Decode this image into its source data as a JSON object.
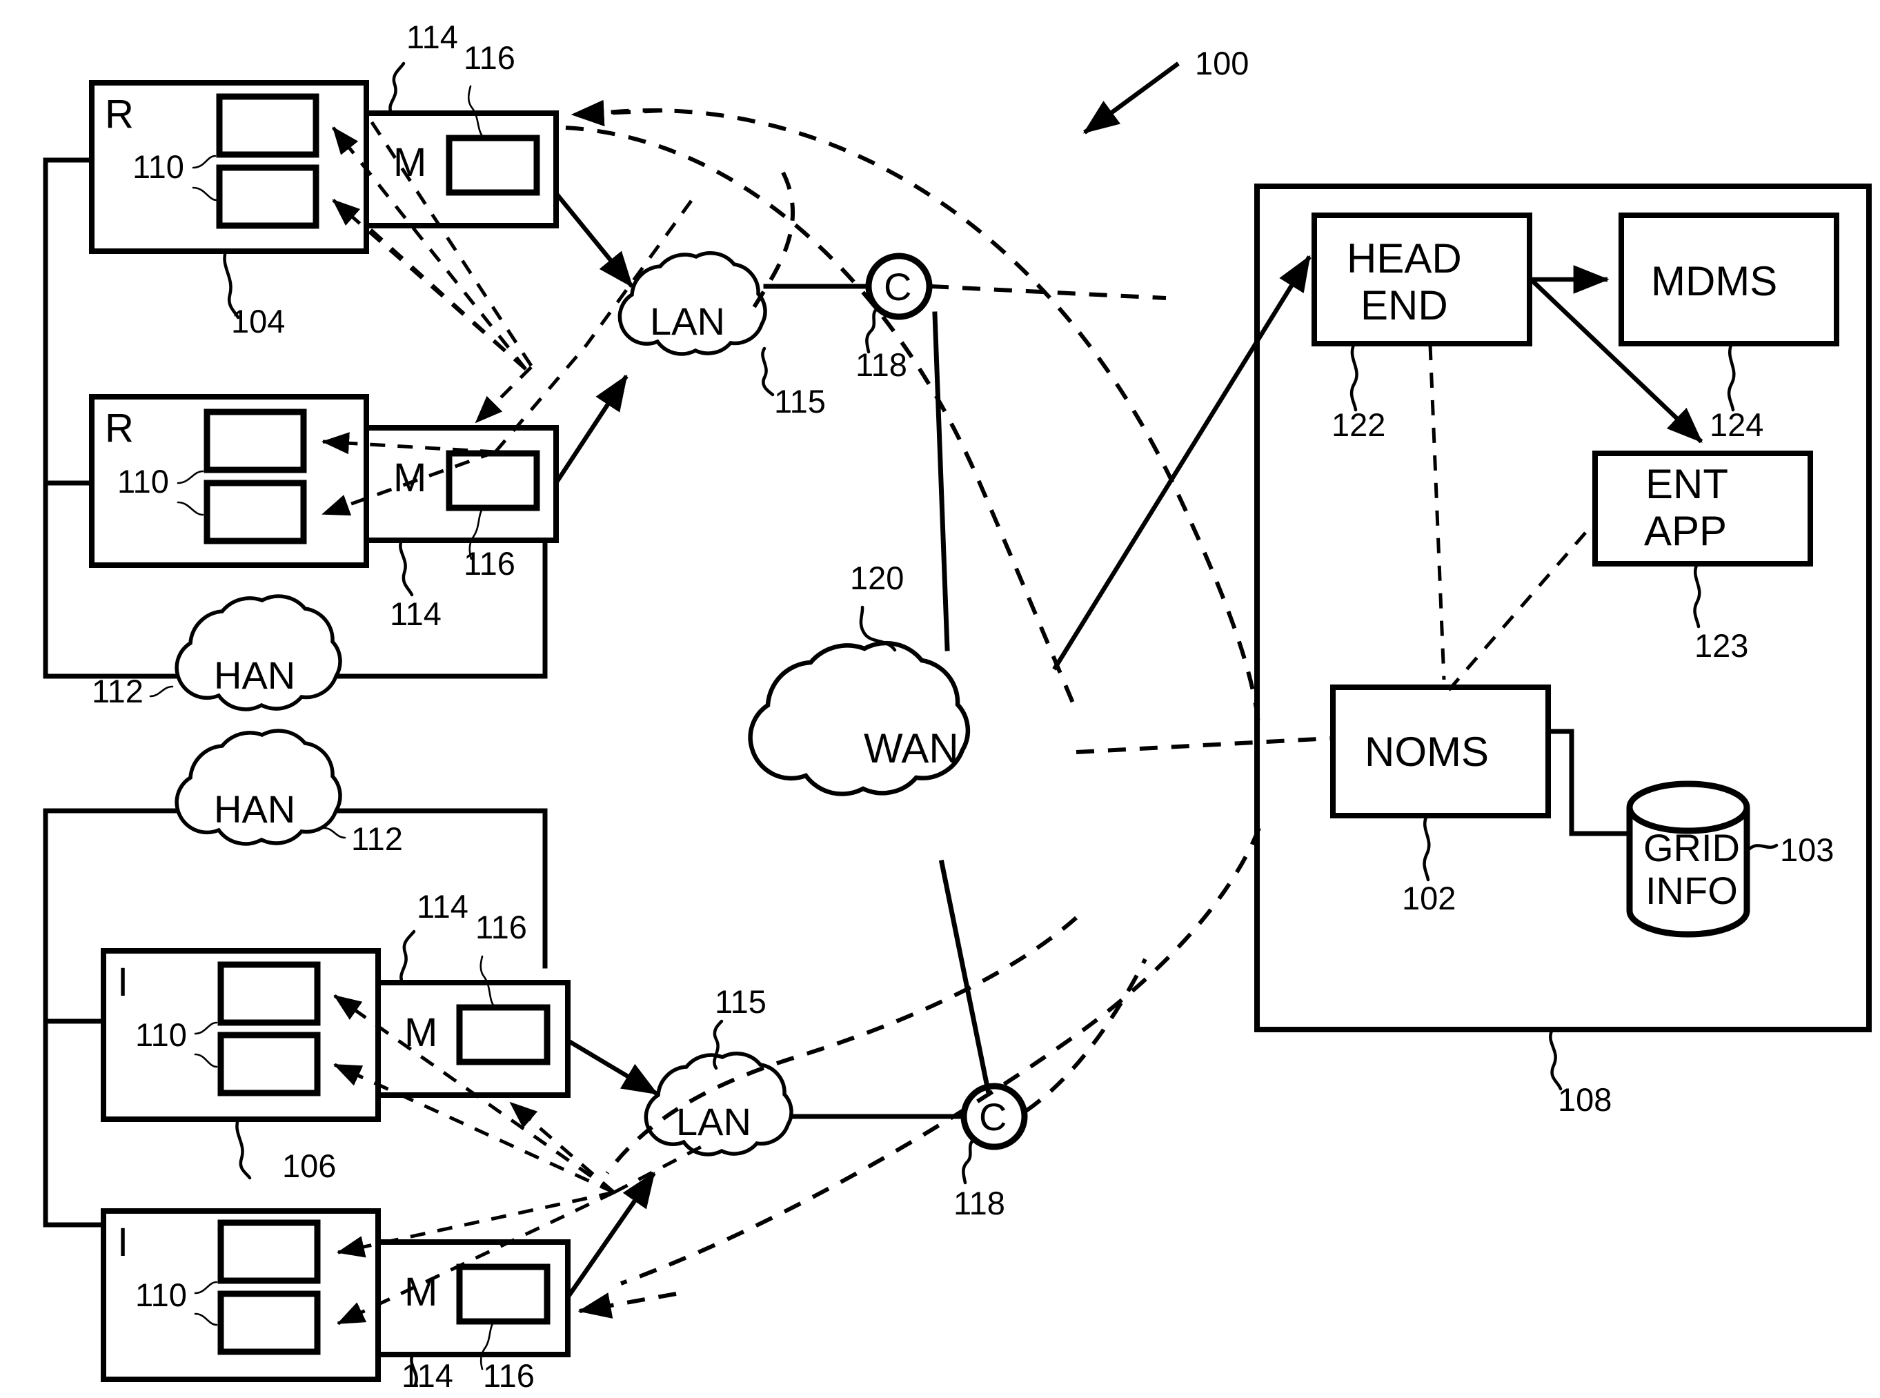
{
  "figure": {
    "title_ref": "100",
    "type": "patent-network-diagram"
  },
  "nodes": {
    "resource_top": {
      "letter": "R",
      "ref": "104"
    },
    "resource_bottom": {
      "letter": "R",
      "ref": "104"
    },
    "inverter_top": {
      "letter": "I",
      "ref": "106"
    },
    "inverter_bottom": {
      "letter": "I",
      "ref": "106"
    },
    "meter_r_top": {
      "letter": "M",
      "ref": "114",
      "inner_ref": "116"
    },
    "meter_r_bottom": {
      "letter": "M",
      "ref": "114",
      "inner_ref": "116"
    },
    "meter_i_top": {
      "letter": "M",
      "ref": "114",
      "inner_ref": "116"
    },
    "meter_i_bottom": {
      "letter": "M",
      "ref": "114",
      "inner_ref": "116"
    },
    "lan_top": {
      "label": "LAN",
      "ref": "115"
    },
    "lan_bottom": {
      "label": "LAN",
      "ref": "115"
    },
    "han_top": {
      "label": "HAN",
      "ref": "112"
    },
    "han_bottom": {
      "label": "HAN",
      "ref": "112"
    },
    "wan": {
      "label": "WAN",
      "ref": "120"
    },
    "collector_top": {
      "label": "C",
      "ref": "118"
    },
    "collector_bottom": {
      "label": "C",
      "ref": "118"
    },
    "head_end": {
      "line1": "HEAD",
      "line2": "END",
      "ref": "122"
    },
    "mdms": {
      "label": "MDMS",
      "ref": "124"
    },
    "ent_app": {
      "line1": "ENT",
      "line2": "APP",
      "ref": "123"
    },
    "noms": {
      "label": "NOMS",
      "ref": "102"
    },
    "grid_info": {
      "line1": "GRID",
      "line2": "INFO",
      "ref": "103"
    },
    "utility_enclosure": {
      "ref": "108"
    }
  },
  "device_refs": {
    "device_inner_top": "110",
    "device_inner_bottom": "110"
  },
  "labels": {
    "ref_100": "100",
    "ref_102": "102",
    "ref_103": "103",
    "ref_104": "104",
    "ref_106": "106",
    "ref_108": "108",
    "ref_110_a": "110",
    "ref_110_b": "110",
    "ref_110_c": "110",
    "ref_110_d": "110",
    "ref_112_a": "112",
    "ref_112_b": "112",
    "ref_114_a": "114",
    "ref_114_b": "114",
    "ref_114_c": "114",
    "ref_114_d": "114",
    "ref_115_a": "115",
    "ref_115_b": "115",
    "ref_116_a": "116",
    "ref_116_b": "116",
    "ref_116_c": "116",
    "ref_116_d": "116",
    "ref_118_a": "118",
    "ref_118_b": "118",
    "ref_120": "120",
    "ref_122": "122",
    "ref_123": "123",
    "ref_124": "124",
    "letter_R_top": "R",
    "letter_R_bottom": "R",
    "letter_I_top": "I",
    "letter_I_bottom": "I",
    "letter_M_1": "M",
    "letter_M_2": "M",
    "letter_M_3": "M",
    "letter_M_4": "M",
    "letter_C_top": "C",
    "letter_C_bottom": "C",
    "text_LAN_top": "LAN",
    "text_LAN_bottom": "LAN",
    "text_HAN_top": "HAN",
    "text_HAN_bottom": "HAN",
    "text_WAN": "WAN",
    "text_HEAD": "HEAD",
    "text_END": "END",
    "text_MDMS": "MDMS",
    "text_ENT": "ENT",
    "text_APP": "APP",
    "text_NOMS": "NOMS",
    "text_GRID": "GRID",
    "text_INFO": "INFO"
  },
  "colors": {
    "stroke": "#000000",
    "background": "#ffffff"
  }
}
